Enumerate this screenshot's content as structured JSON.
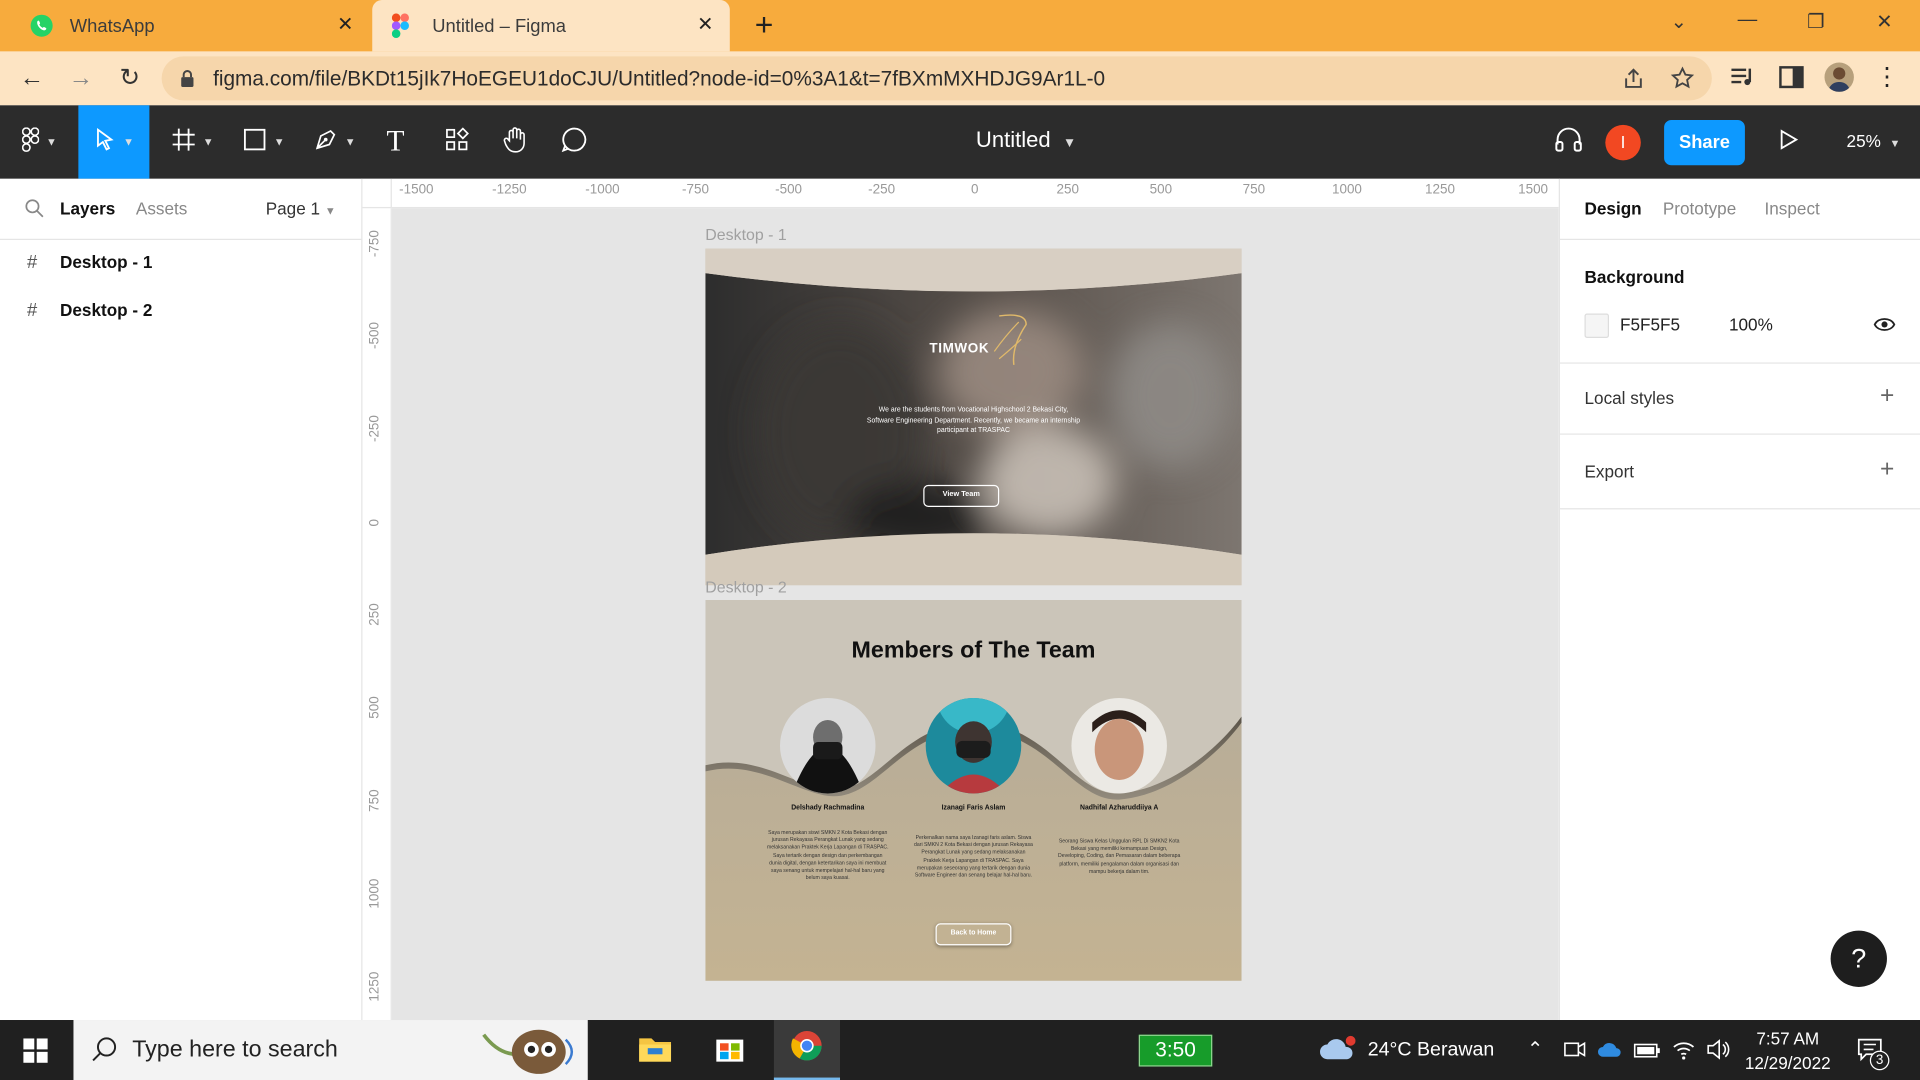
{
  "browser": {
    "tabs": [
      {
        "title": "WhatsApp",
        "icon": "whatsapp-icon",
        "active": false
      },
      {
        "title": "Untitled – Figma",
        "icon": "figma-icon",
        "active": true
      }
    ],
    "url": "figma.com/file/BKDt15jIk7HoEGEU1doCJU/Untitled?node-id=0%3A1&t=7fBXmMXHDJG9Ar1L-0",
    "accent": "#f7ab3d"
  },
  "figma": {
    "file_title": "Untitled",
    "user_initial": "I",
    "share_label": "Share",
    "zoom": "25%",
    "left_tabs": {
      "layers": "Layers",
      "assets": "Assets",
      "page": "Page 1"
    },
    "layers": [
      "Desktop - 1",
      "Desktop - 2"
    ],
    "right_tabs": {
      "design": "Design",
      "prototype": "Prototype",
      "inspect": "Inspect"
    },
    "background": {
      "title": "Background",
      "hex": "F5F5F5",
      "opacity": "100%"
    },
    "local_styles": "Local styles",
    "export": "Export",
    "help": "?",
    "ruler_top": [
      "-1500",
      "-1250",
      "-1000",
      "-750",
      "-500",
      "-250",
      "0",
      "250",
      "500",
      "750",
      "1000",
      "1250",
      "1500"
    ],
    "ruler_left": [
      "-750",
      "-500",
      "-250",
      "0",
      "250",
      "500",
      "750",
      "1000",
      "1250"
    ]
  },
  "design": {
    "frame1": {
      "label": "Desktop - 1",
      "brand": "TIMWOK",
      "text": "We are the  students from Vocational Highschool 2 Bekasi City, Software Engineering Department. Recently, we became an internship participant at TRASPAC",
      "button": "View Team"
    },
    "frame2": {
      "label": "Desktop - 2",
      "heading": "Members of The Team",
      "members": [
        {
          "name": "Delshady Rachmadina",
          "desc": "Saya merupakan siswi SMKN 2 Kota Bekasi dengan jurusan Rekayasa Perangkat Lunak yang sedang melaksanakan Praktek Kerja Lapangan di TRASPAC. Saya tertarik dengan design dan perkembangan dunia digital, dengan ketertarikan saya ini membuat saya senang untuk mempelajari hal-hal baru yang belum saya kuasai."
        },
        {
          "name": "Izanagi Faris Aslam",
          "desc": "Perkenalkan nama saya Izanagi faris aslam. Siswa dari SMKN 2 Kota Bekasi dengan jurusan Rekayasa Perangkat Lunak yang sedang melaksanakan Praktek Kerja Lapangan di TRASPAC. Saya merupakan seseorang yang tertarik dengan dunia Software Engineer dan senang belajar hal-hal baru."
        },
        {
          "name": "Nadhifal Azharuddiiya A",
          "desc": "Seorang Siswa Kelas Unggulan RPL Di SMKN2 Kota Bekasi yang memiliki kemampuan Design, Developing, Coding, dan Pemasaran dalam beberapa platform, memiliki pengalaman dalam organisasi dan mampu bekerja dalam tim."
        }
      ],
      "button": "Back to Home"
    }
  },
  "taskbar": {
    "search_placeholder": "Type here to search",
    "battery_time": "3:50",
    "weather": "24°C  Berawan",
    "time": "7:57 AM",
    "date": "12/29/2022",
    "notifications": "3"
  }
}
